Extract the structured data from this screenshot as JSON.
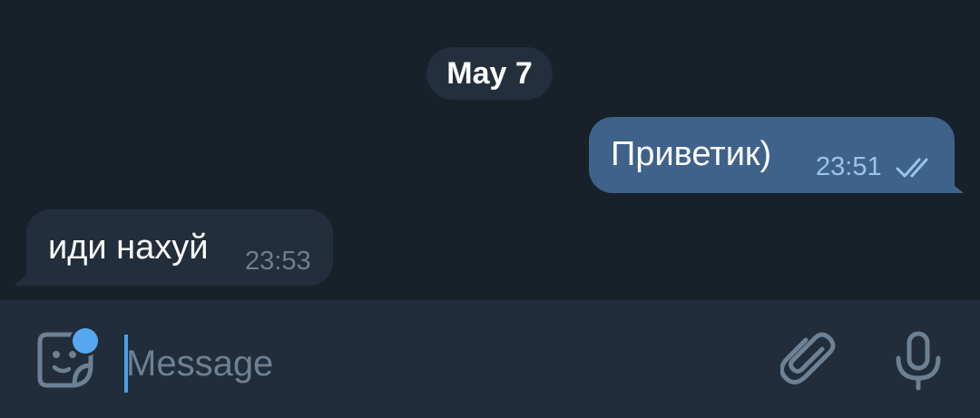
{
  "chat": {
    "date_label": "May 7",
    "messages": [
      {
        "direction": "outgoing",
        "text": "Приветик)",
        "time": "23:51",
        "status_icon": "double-check-icon"
      },
      {
        "direction": "incoming",
        "text": "иди нахуй",
        "time": "23:53"
      }
    ]
  },
  "input_bar": {
    "placeholder": "Message",
    "value": "",
    "left_icon": "sticker-icon",
    "right_icons": [
      "paperclip-icon",
      "microphone-icon"
    ]
  },
  "colors": {
    "background": "#18202a",
    "outgoing_bubble": "#3e6289",
    "incoming_bubble": "#222e3b",
    "input_bar": "#212d3a",
    "accent": "#56a7f0"
  }
}
